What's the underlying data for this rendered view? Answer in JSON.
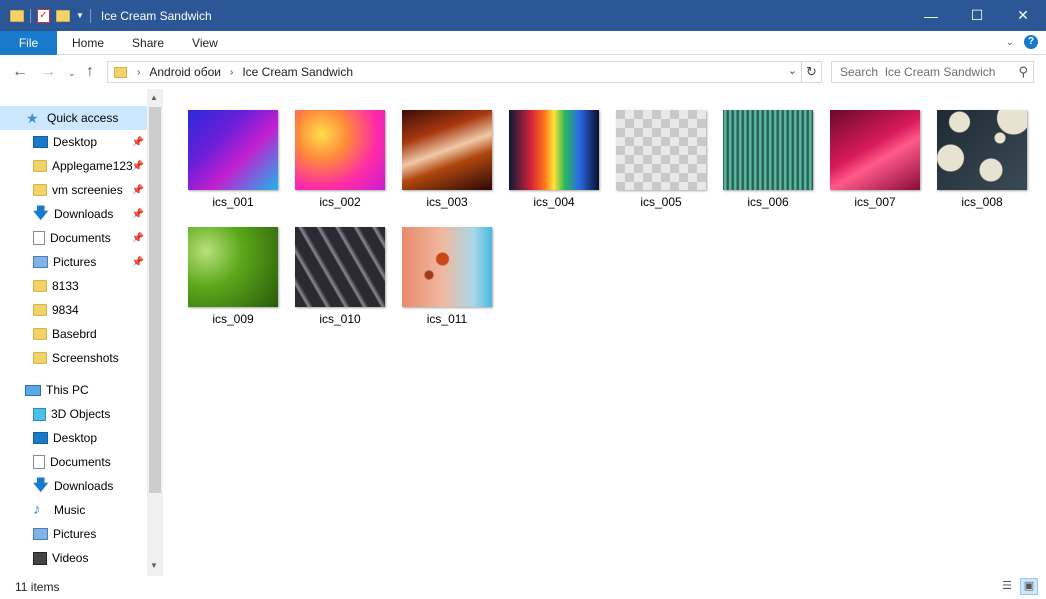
{
  "window": {
    "title": "Ice Cream Sandwich",
    "minimize_icon": "minimize-icon",
    "maximize_icon": "maximize-icon",
    "close_icon": "close-icon"
  },
  "ribbon": {
    "tabs": [
      "File",
      "Home",
      "Share",
      "View"
    ]
  },
  "address": {
    "crumbs": [
      "Android обои",
      "Ice Cream Sandwich"
    ],
    "search_placeholder": "Search  Ice Cream Sandwich"
  },
  "sidebar": {
    "items": [
      {
        "label": "Quick access",
        "icon": "star-icon",
        "pinned": false
      },
      {
        "label": "Desktop",
        "icon": "desktop-icon",
        "pinned": true
      },
      {
        "label": "Applegame123",
        "icon": "folder-icon",
        "pinned": true
      },
      {
        "label": "vm screenies",
        "icon": "folder-icon",
        "pinned": true
      },
      {
        "label": "Downloads",
        "icon": "download-icon",
        "pinned": true
      },
      {
        "label": "Documents",
        "icon": "documents-icon",
        "pinned": true
      },
      {
        "label": "Pictures",
        "icon": "pictures-icon",
        "pinned": true
      },
      {
        "label": "8133",
        "icon": "folder-icon",
        "pinned": false
      },
      {
        "label": "9834",
        "icon": "folder-icon",
        "pinned": false
      },
      {
        "label": "Basebrd",
        "icon": "folder-icon",
        "pinned": false
      },
      {
        "label": "Screenshots",
        "icon": "folder-icon",
        "pinned": false
      },
      {
        "label": "This PC",
        "icon": "this-pc-icon",
        "pinned": false
      },
      {
        "label": "3D Objects",
        "icon": "3d-objects-icon",
        "pinned": false
      },
      {
        "label": "Desktop",
        "icon": "desktop-icon",
        "pinned": false
      },
      {
        "label": "Documents",
        "icon": "documents-icon",
        "pinned": false
      },
      {
        "label": "Downloads",
        "icon": "download-icon",
        "pinned": false
      },
      {
        "label": "Music",
        "icon": "music-icon",
        "pinned": false
      },
      {
        "label": "Pictures",
        "icon": "pictures-icon",
        "pinned": false
      },
      {
        "label": "Videos",
        "icon": "videos-icon",
        "pinned": false
      }
    ]
  },
  "files": [
    {
      "name": "ics_001"
    },
    {
      "name": "ics_002"
    },
    {
      "name": "ics_003"
    },
    {
      "name": "ics_004"
    },
    {
      "name": "ics_005"
    },
    {
      "name": "ics_006"
    },
    {
      "name": "ics_007"
    },
    {
      "name": "ics_008"
    },
    {
      "name": "ics_009"
    },
    {
      "name": "ics_010"
    },
    {
      "name": "ics_011"
    }
  ],
  "status": {
    "item_count": "11 items"
  }
}
